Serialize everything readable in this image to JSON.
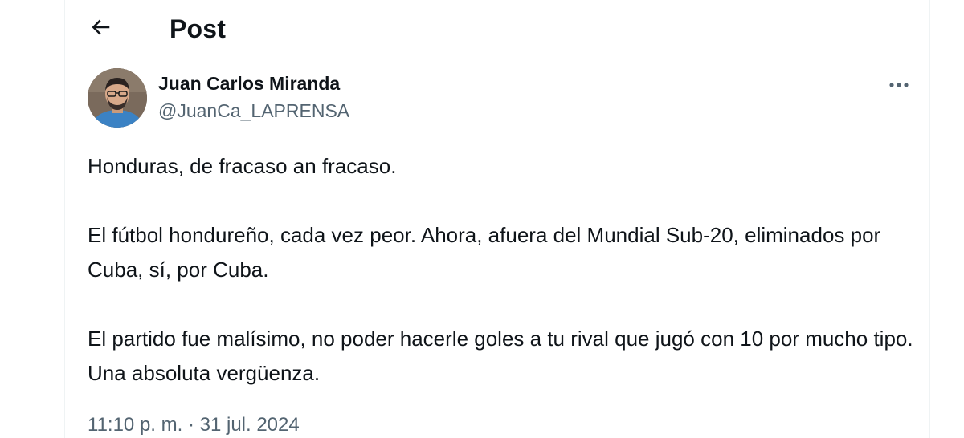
{
  "header": {
    "title": "Post"
  },
  "author": {
    "name": "Juan Carlos Miranda",
    "handle": "@JuanCa_LAPRENSA"
  },
  "tweet": {
    "paragraphs": [
      "Honduras, de fracaso an fracaso.",
      "El fútbol hondureño, cada vez peor. Ahora, afuera del Mundial Sub-20, eliminados por Cuba, sí, por Cuba.",
      "El partido fue malísimo, no poder hacerle goles a tu rival que jugó con 10 por mucho tipo. Una absoluta vergüenza."
    ],
    "timestamp": "11:10 p. m. · 31 jul. 2024"
  },
  "icons": {
    "back": "arrow-left-icon",
    "more": "more-horizontal-icon"
  },
  "colors": {
    "text_primary": "#0f1419",
    "text_secondary": "#536471",
    "border": "#eff3f4"
  }
}
